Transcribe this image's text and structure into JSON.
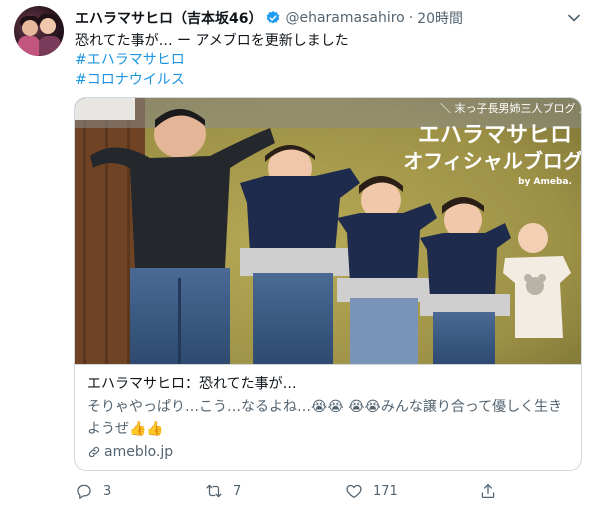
{
  "tweet": {
    "display_name": "エハラマサヒロ（吉本坂46）",
    "handle": "@eharamasahiro",
    "separator": "·",
    "time": "20時間",
    "text": "恐れてた事が… ー アメブロを更新しました",
    "hashtags": [
      "#エハラマサヒロ",
      "#コロナウイルス"
    ]
  },
  "card": {
    "banner_subtitle": "＼ 末っ子長男姉三人ブログ ／",
    "banner_title_line1": "エハラマサヒロ",
    "banner_title_line2": "オフィシャルブログ",
    "banner_by": "by Ameba.",
    "title": "エハラマサヒロ：恐れてた事が…",
    "description": "そりゃやっぱり…こう…なるよね…😭😭 😭😭みんな譲り合って優しく生きようぜ👍👍",
    "domain": "ameblo.jp"
  },
  "actions": {
    "reply_count": "3",
    "retweet_count": "7",
    "like_count": "171"
  },
  "icons": {
    "verified": "verified-badge-icon",
    "caret": "chevron-down-icon",
    "link": "link-icon",
    "reply": "reply-icon",
    "retweet": "retweet-icon",
    "like": "heart-icon",
    "share": "share-icon"
  },
  "colors": {
    "link_blue": "#1b95e0",
    "secondary_text": "#536471",
    "border": "#cfd9de",
    "banner_text": "#ffffff"
  }
}
